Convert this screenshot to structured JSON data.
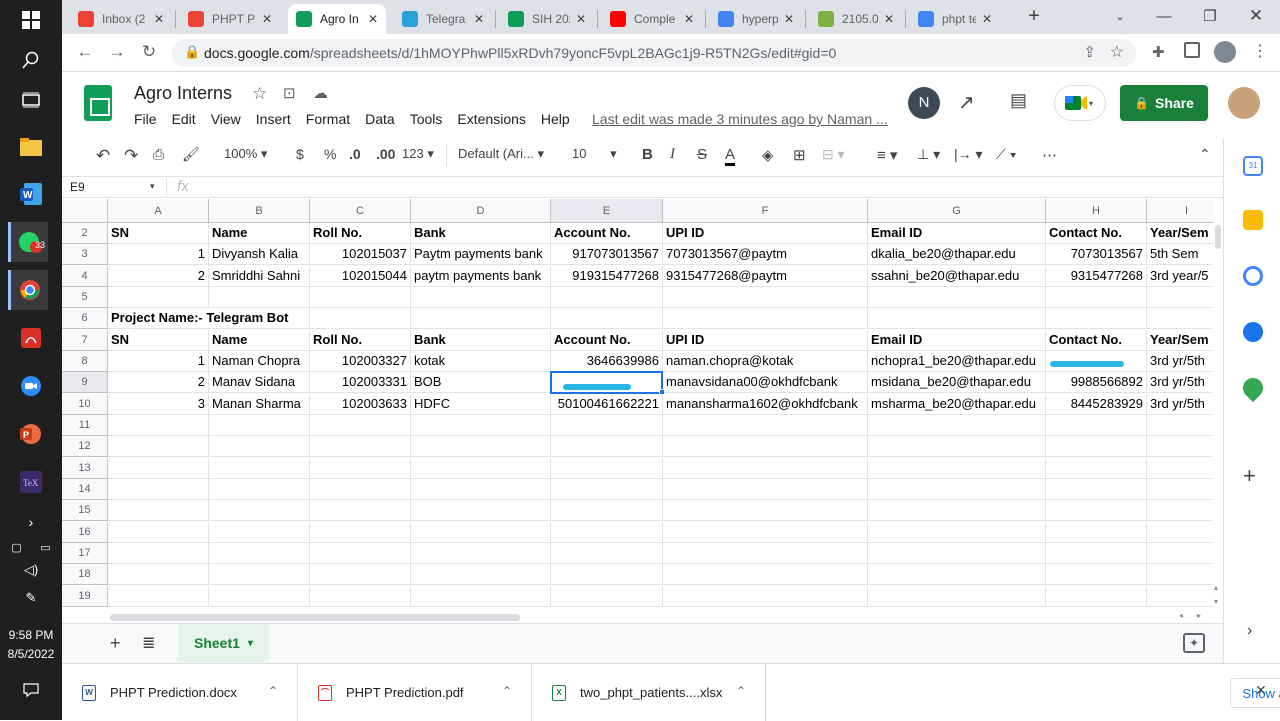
{
  "taskbar": {
    "time": "9:58 PM",
    "date": "8/5/2022",
    "whatsapp_badge": "33",
    "apps": [
      "windows-start",
      "search",
      "task-view",
      "file-explorer",
      "word",
      "whatsapp",
      "chrome",
      "acrobat",
      "zoom",
      "powerpoint",
      "tex"
    ]
  },
  "browser": {
    "tabs": [
      {
        "label": "Inbox (2",
        "favicon": "gmail",
        "color": "#ea4335"
      },
      {
        "label": "PHPT P",
        "favicon": "gmail",
        "color": "#ea4335"
      },
      {
        "label": "Agro In",
        "favicon": "sheets",
        "color": "#0f9d58",
        "active": true
      },
      {
        "label": "Telegra",
        "favicon": "telegram",
        "color": "#2aa1da"
      },
      {
        "label": "SIH 202",
        "favicon": "sheets",
        "color": "#0f9d58"
      },
      {
        "label": "Comple",
        "favicon": "youtube",
        "color": "#ff0000"
      },
      {
        "label": "hyperp",
        "favicon": "google",
        "color": "#4285f4"
      },
      {
        "label": "2105.0",
        "favicon": "emoji",
        "color": "#7cb342"
      },
      {
        "label": "phpt te",
        "favicon": "google",
        "color": "#4285f4"
      }
    ],
    "url_main": "docs.google.com",
    "url_rest": "/spreadsheets/d/1hMOYPhwPll5xRDvh79yoncF5vpL2BAGc1j9-R5TN2Gs/edit#gid=0"
  },
  "sheets": {
    "title": "Agro Interns",
    "menu": [
      "File",
      "Edit",
      "View",
      "Insert",
      "Format",
      "Data",
      "Tools",
      "Extensions",
      "Help"
    ],
    "last_edit": "Last edit was made 3 minutes ago by Naman ...",
    "avatar_initial": "N",
    "share_label": "Share",
    "toolbar": {
      "zoom": "100%",
      "currency": "$",
      "percent": "%",
      "dec_less": ".0",
      "dec_more": ".00",
      "format": "123",
      "font": "Default (Ari...",
      "font_size": "10"
    },
    "name_box": "E9",
    "fx": "fx",
    "columns": [
      "A",
      "B",
      "C",
      "D",
      "E",
      "F",
      "G",
      "H",
      "I"
    ],
    "selected_col": "E",
    "selected_row": "9",
    "rows": [
      {
        "n": "2",
        "cells": [
          "SN",
          "Name",
          "Roll No.",
          "Bank",
          "Account No.",
          "UPI ID",
          "Email ID",
          "Contact No.",
          "Year/Sem"
        ],
        "bold": true
      },
      {
        "n": "3",
        "cells": [
          "1",
          "Divyansh Kalia",
          "102015037",
          "Paytm payments bank",
          "917073013567",
          "7073013567@paytm",
          "dkalia_be20@thapar.edu",
          "7073013567",
          "5th Sem"
        ]
      },
      {
        "n": "4",
        "cells": [
          "2",
          "Smriddhi Sahni",
          "102015044",
          "paytm payments bank",
          "919315477268",
          "9315477268@paytm",
          "ssahni_be20@thapar.edu",
          "9315477268",
          "3rd year/5"
        ]
      },
      {
        "n": "5",
        "cells": [
          "",
          "",
          "",
          "",
          "",
          "",
          "",
          "",
          ""
        ]
      },
      {
        "n": "6",
        "cells": [
          "Project Name:- Telegram Bot",
          "",
          "",
          "",
          "",
          "",
          "",
          "",
          ""
        ],
        "bold": true
      },
      {
        "n": "7",
        "cells": [
          "SN",
          "Name",
          "Roll No.",
          "Bank",
          "Account No.",
          "UPI ID",
          "Email ID",
          "Contact No.",
          "Year/Sem"
        ],
        "bold": true
      },
      {
        "n": "8",
        "cells": [
          "1",
          "Naman Chopra",
          "102003327",
          "kotak",
          "3646639986",
          "naman.chopra@kotak",
          "nchopra1_be20@thapar.edu",
          "",
          "3rd yr/5th"
        ]
      },
      {
        "n": "9",
        "cells": [
          "2",
          "Manav Sidana",
          "102003331",
          "BOB",
          "",
          "manavsidana00@okhdfcbank",
          "msidana_be20@thapar.edu",
          "9988566892",
          "3rd yr/5th"
        ]
      },
      {
        "n": "10",
        "cells": [
          "3",
          "Manan Sharma",
          "102003633",
          "HDFC",
          "50100461662221",
          "manansharma1602@okhdfcbank",
          "msharma_be20@thapar.edu",
          "8445283929",
          "3rd yr/5th"
        ]
      },
      {
        "n": "11",
        "cells": []
      },
      {
        "n": "12",
        "cells": []
      },
      {
        "n": "13",
        "cells": []
      },
      {
        "n": "14",
        "cells": []
      },
      {
        "n": "15",
        "cells": []
      },
      {
        "n": "16",
        "cells": []
      },
      {
        "n": "17",
        "cells": []
      },
      {
        "n": "18",
        "cells": []
      },
      {
        "n": "19",
        "cells": []
      }
    ],
    "sheet_tab": "Sheet1"
  },
  "downloads": {
    "items": [
      {
        "name": "PHPT Prediction.docx",
        "type": "docx",
        "color": "#2b579a"
      },
      {
        "name": "PHPT Prediction.pdf",
        "type": "pdf",
        "color": "#d93025"
      },
      {
        "name": "two_phpt_patients....xlsx",
        "type": "xlsx",
        "color": "#188038"
      }
    ],
    "show_all": "Show all"
  },
  "colors": {
    "sheets_green": "#0f9d58",
    "share_green": "#188038",
    "selection_blue": "#1a73e8",
    "scribble": "#2ab7e6"
  }
}
